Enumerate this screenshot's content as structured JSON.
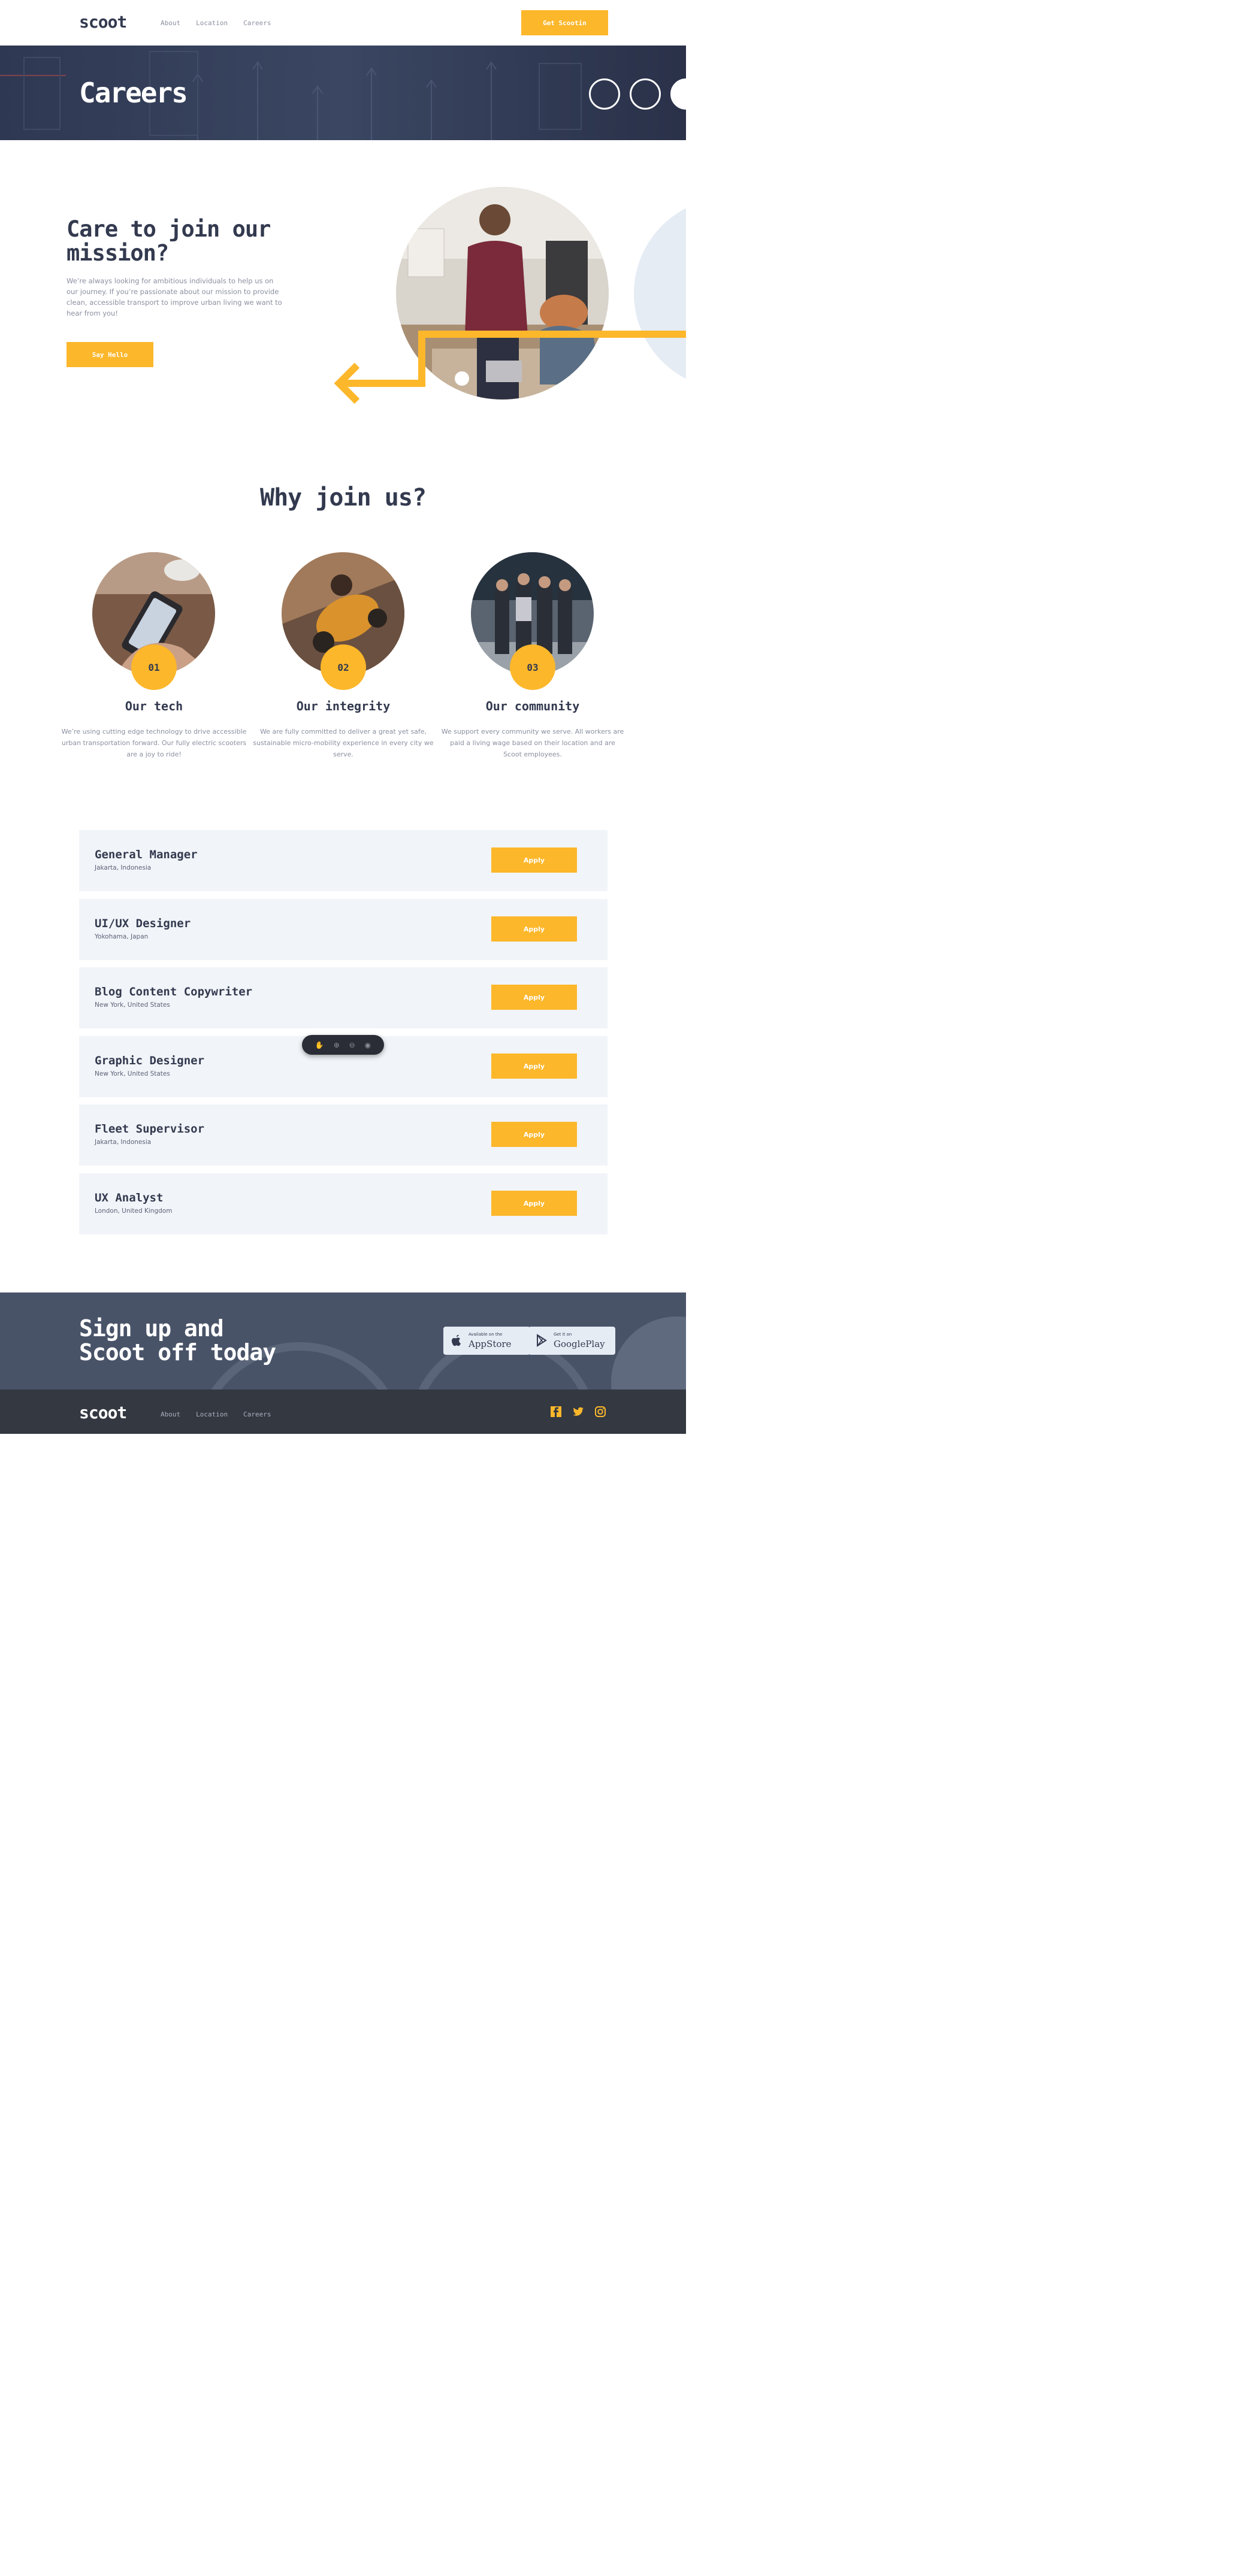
{
  "brand": {
    "logo": "scoot",
    "accent": "#fcb72b",
    "dark": "#333a4f"
  },
  "header": {
    "nav": [
      "About",
      "Location",
      "Careers"
    ],
    "cta": "Get Scootin"
  },
  "hero": {
    "title": "Careers"
  },
  "mission": {
    "title": "Care to join our mission?",
    "text": "We’re always looking for ambitious individuals to help us on our journey. If you’re passionate about our mission to provide clean, accessible transport to improve urban living we want to hear from you!",
    "button": "Say Hello"
  },
  "why": {
    "title": "Why join us?",
    "features": [
      {
        "number": "01",
        "title": "Our tech",
        "text": "We’re using cutting edge technology to drive accessible urban transportation forward. Our fully electric scooters are a joy to ride!"
      },
      {
        "number": "02",
        "title": "Our integrity",
        "text": "We are fully committed to deliver a great yet safe, sustainable micro-mobility experience in every city we serve."
      },
      {
        "number": "03",
        "title": "Our community",
        "text": "We support every community we serve. All workers are paid a living wage based on their location and are Scoot employees."
      }
    ]
  },
  "jobs": [
    {
      "title": "General Manager",
      "location": "Jakarta, Indonesia",
      "button": "Apply"
    },
    {
      "title": "UI/UX Designer",
      "location": "Yokohama, Japan",
      "button": "Apply"
    },
    {
      "title": "Blog Content Copywriter",
      "location": "New York, United States",
      "button": "Apply"
    },
    {
      "title": "Graphic Designer",
      "location": "New York, United States",
      "button": "Apply"
    },
    {
      "title": "Fleet Supervisor",
      "location": "Jakarta, Indonesia",
      "button": "Apply"
    },
    {
      "title": "UX Analyst",
      "location": "London, United Kingdom",
      "button": "Apply"
    }
  ],
  "toolbar": {
    "icons": [
      "hand-icon",
      "zoom-in-icon",
      "zoom-out-icon",
      "fit-icon"
    ]
  },
  "signup": {
    "title_line1": "Sign up and",
    "title_line2": "Scoot off today",
    "appstore": {
      "small": "Available on the",
      "big": "AppStore"
    },
    "googleplay": {
      "small": "Get it on",
      "big": "GooglePlay"
    }
  },
  "footer": {
    "logo": "scoot",
    "nav": [
      "About",
      "Location",
      "Careers"
    ],
    "social": [
      "facebook-icon",
      "twitter-icon",
      "instagram-icon"
    ]
  }
}
